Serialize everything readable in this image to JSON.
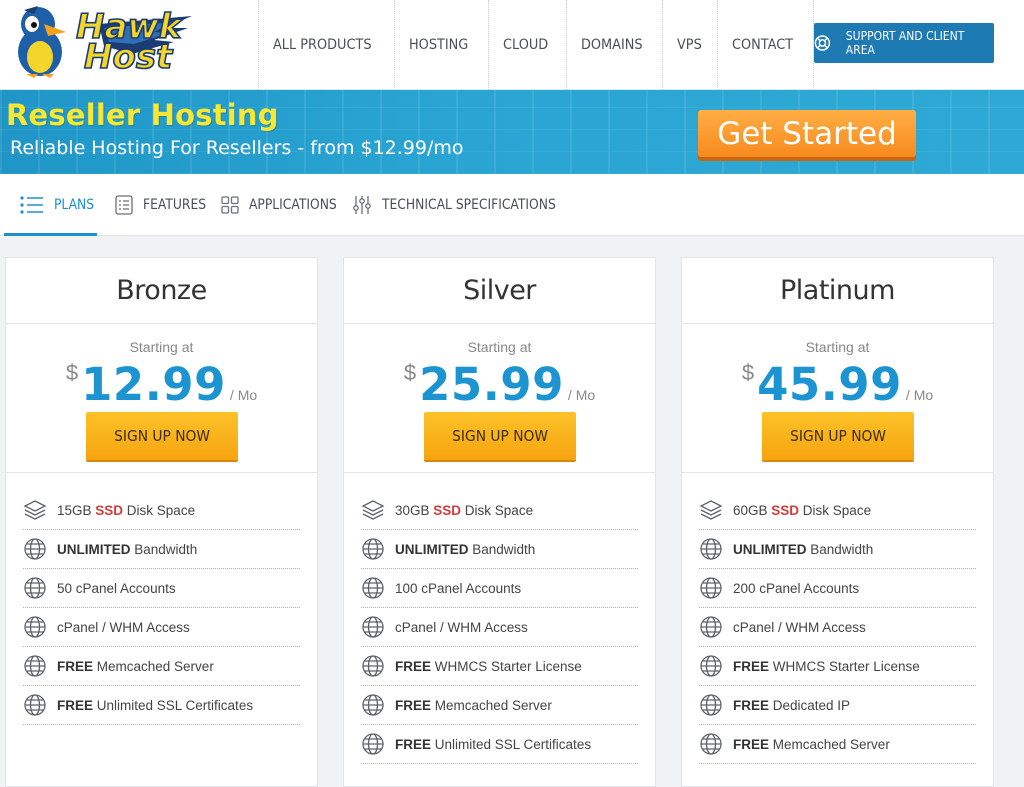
{
  "header": {
    "logo_text_line1": "Hawk",
    "logo_text_line2": "Host",
    "nav": [
      "ALL PRODUCTS",
      "HOSTING",
      "CLOUD",
      "DOMAINS",
      "VPS",
      "CONTACT"
    ],
    "support_button": "SUPPORT AND CLIENT AREA"
  },
  "banner": {
    "title": "Reseller Hosting",
    "subtitle": "Reliable Hosting For Resellers - from $12.99/mo",
    "cta": "Get Started"
  },
  "tabs": [
    {
      "label": "PLANS",
      "icon": "list-icon",
      "active": true
    },
    {
      "label": "FEATURES",
      "icon": "features-icon",
      "active": false
    },
    {
      "label": "APPLICATIONS",
      "icon": "grid-icon",
      "active": false
    },
    {
      "label": "TECHNICAL SPECIFICATIONS",
      "icon": "sliders-icon",
      "active": false
    }
  ],
  "plans": [
    {
      "name": "Bronze",
      "starting_label": "Starting at",
      "currency": "$",
      "price": "12.99",
      "period": "/ Mo",
      "signup": "SIGN UP NOW",
      "features": [
        {
          "pre": "15GB ",
          "hl": "SSD",
          "post": " Disk Space",
          "icon": "layers-icon"
        },
        {
          "bold": "UNLIMITED",
          "post": " Bandwidth",
          "icon": "globe-icon"
        },
        {
          "post": "50 cPanel Accounts",
          "icon": "globe-icon"
        },
        {
          "post": "cPanel / WHM Access",
          "icon": "globe-icon"
        },
        {
          "bold": "FREE",
          "post": " Memcached Server",
          "icon": "globe-icon"
        },
        {
          "bold": "FREE",
          "post": " Unlimited SSL Certificates",
          "icon": "globe-icon"
        }
      ]
    },
    {
      "name": "Silver",
      "starting_label": "Starting at",
      "currency": "$",
      "price": "25.99",
      "period": "/ Mo",
      "signup": "SIGN UP NOW",
      "features": [
        {
          "pre": "30GB ",
          "hl": "SSD",
          "post": " Disk Space",
          "icon": "layers-icon"
        },
        {
          "bold": "UNLIMITED",
          "post": " Bandwidth",
          "icon": "globe-icon"
        },
        {
          "post": "100 cPanel Accounts",
          "icon": "globe-icon"
        },
        {
          "post": "cPanel / WHM Access",
          "icon": "globe-icon"
        },
        {
          "bold": "FREE",
          "post": " WHMCS Starter License",
          "icon": "globe-icon"
        },
        {
          "bold": "FREE",
          "post": " Memcached Server",
          "icon": "globe-icon"
        },
        {
          "bold": "FREE",
          "post": " Unlimited SSL Certificates",
          "icon": "globe-icon"
        }
      ]
    },
    {
      "name": "Platinum",
      "starting_label": "Starting at",
      "currency": "$",
      "price": "45.99",
      "period": "/ Mo",
      "signup": "SIGN UP NOW",
      "features": [
        {
          "pre": "60GB ",
          "hl": "SSD",
          "post": " Disk Space",
          "icon": "layers-icon"
        },
        {
          "bold": "UNLIMITED",
          "post": " Bandwidth",
          "icon": "globe-icon"
        },
        {
          "post": "200 cPanel Accounts",
          "icon": "globe-icon"
        },
        {
          "post": "cPanel / WHM Access",
          "icon": "globe-icon"
        },
        {
          "bold": "FREE",
          "post": " WHMCS Starter License",
          "icon": "globe-icon"
        },
        {
          "bold": "FREE",
          "post": " Dedicated IP",
          "icon": "globe-icon"
        },
        {
          "bold": "FREE",
          "post": " Memcached Server",
          "icon": "globe-icon"
        }
      ]
    }
  ],
  "colors": {
    "brand_blue": "#1d8fce",
    "banner_blue": "#2aa5d3",
    "banner_title_yellow": "#f6e833",
    "cta_orange": "#f78a1e",
    "signup_yellow": "#f6a410",
    "ssd_red": "#d63b3b"
  }
}
